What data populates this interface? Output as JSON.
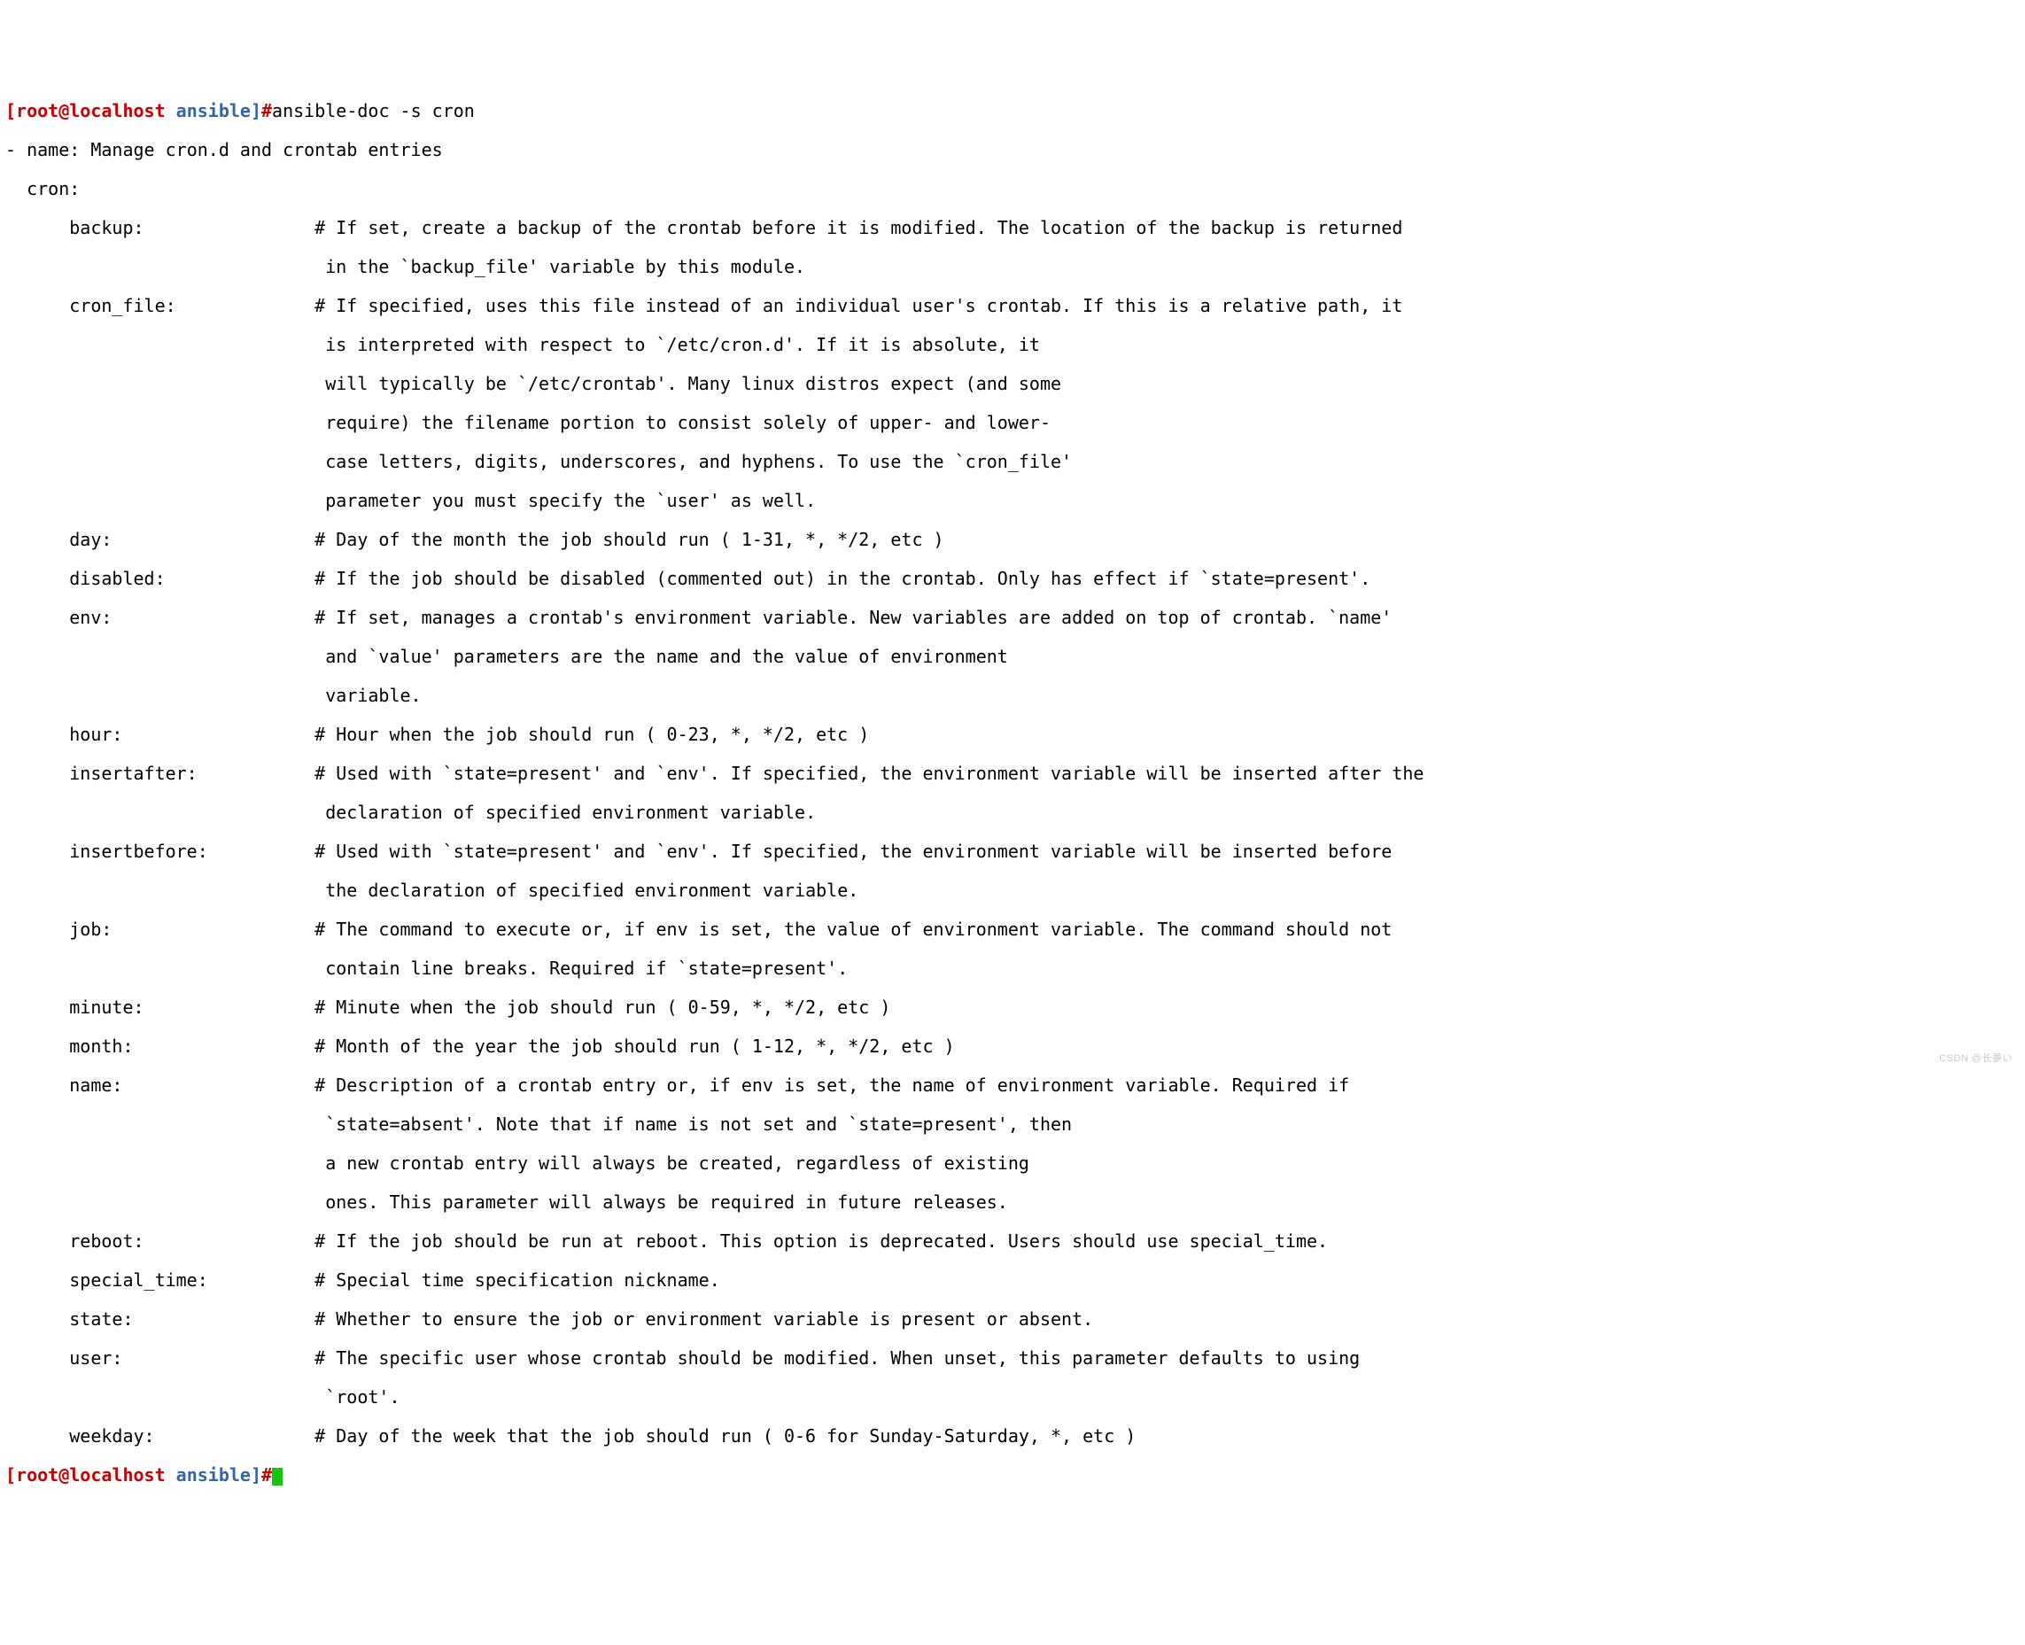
{
  "prompt": {
    "user": "[root@localhost",
    "path": " ansible]",
    "hash": "#"
  },
  "command": "ansible-doc -s cron",
  "header": {
    "line1": "- name: Manage cron.d and crontab entries",
    "line2": "  cron:"
  },
  "params": {
    "backup": {
      "name": "backup:",
      "d1": "# If set, create a backup of the crontab before it is modified. The location of the backup is returned",
      "d2": "in the `backup_file' variable by this module."
    },
    "cron_file": {
      "name": "cron_file:",
      "d1": "# If specified, uses this file instead of an individual user's crontab. If this is a relative path, it",
      "d2": "is interpreted with respect to `/etc/cron.d'. If it is absolute, it",
      "d3": "will typically be `/etc/crontab'. Many linux distros expect (and some",
      "d4": "require) the filename portion to consist solely of upper- and lower-",
      "d5": "case letters, digits, underscores, and hyphens. To use the `cron_file'",
      "d6": "parameter you must specify the `user' as well."
    },
    "day": {
      "name": "day:",
      "d1": "# Day of the month the job should run ( 1-31, *, */2, etc )"
    },
    "disabled": {
      "name": "disabled:",
      "d1": "# If the job should be disabled (commented out) in the crontab. Only has effect if `state=present'."
    },
    "env": {
      "name": "env:",
      "d1": "# If set, manages a crontab's environment variable. New variables are added on top of crontab. `name'",
      "d2": "and `value' parameters are the name and the value of environment",
      "d3": "variable."
    },
    "hour": {
      "name": "hour:",
      "d1": "# Hour when the job should run ( 0-23, *, */2, etc )"
    },
    "insertafter": {
      "name": "insertafter:",
      "d1": "# Used with `state=present' and `env'. If specified, the environment variable will be inserted after the",
      "d2": "declaration of specified environment variable."
    },
    "insertbefore": {
      "name": "insertbefore:",
      "d1": "# Used with `state=present' and `env'. If specified, the environment variable will be inserted before",
      "d2": "the declaration of specified environment variable."
    },
    "job": {
      "name": "job:",
      "d1": "# The command to execute or, if env is set, the value of environment variable. The command should not",
      "d2": "contain line breaks. Required if `state=present'."
    },
    "minute": {
      "name": "minute:",
      "d1": "# Minute when the job should run ( 0-59, *, */2, etc )"
    },
    "month": {
      "name": "month:",
      "d1": "# Month of the year the job should run ( 1-12, *, */2, etc )"
    },
    "nameparam": {
      "name": "name:",
      "d1": "# Description of a crontab entry or, if env is set, the name of environment variable. Required if",
      "d2": "`state=absent'. Note that if name is not set and `state=present', then",
      "d3": "a new crontab entry will always be created, regardless of existing",
      "d4": "ones. This parameter will always be required in future releases."
    },
    "reboot": {
      "name": "reboot:",
      "d1": "# If the job should be run at reboot. This option is deprecated. Users should use special_time."
    },
    "special_time": {
      "name": "special_time:",
      "d1": "# Special time specification nickname."
    },
    "state": {
      "name": "state:",
      "d1": "# Whether to ensure the job or environment variable is present or absent."
    },
    "user": {
      "name": "user:",
      "d1": "# The specific user whose crontab should be modified. When unset, this parameter defaults to using",
      "d2": "`root'."
    },
    "weekday": {
      "name": "weekday:",
      "d1": "# Day of the week that the job should run ( 0-6 for Sunday-Saturday, *, etc )"
    }
  },
  "watermark": "CSDN @长夢い"
}
